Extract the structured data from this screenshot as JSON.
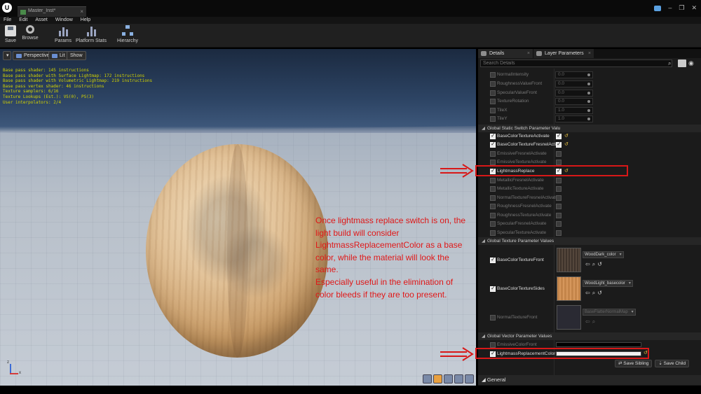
{
  "titlebar": {
    "logo": "U",
    "tab_title": "Master_Inst*",
    "tab_close": "×",
    "controls": [
      "–",
      "❐",
      "✕"
    ]
  },
  "menu": [
    "File",
    "Edit",
    "Asset",
    "Window",
    "Help"
  ],
  "toolbar": {
    "save": "Save",
    "browse": "Browse",
    "params": "Params",
    "platform_stats": "Platform Stats",
    "hierarchy": "Hierarchy"
  },
  "viewport": {
    "menu_caret": "▾",
    "perspective": "Perspective",
    "lit": "Lit",
    "show": "Show",
    "stats": [
      "Base pass shader: 145 instructions",
      "Base pass shader with Surface Lightmap: 172 instructions",
      "Base pass shader with Volumetric Lightmap: 219 instructions",
      "Base pass vertex shader: 46 instructions",
      "Texture samplers: 6/16",
      "Texture Lookups (Est.): VS(0), PS(3)",
      "User interpolators: 2/4"
    ],
    "axis_z": "z",
    "axis_x": "x"
  },
  "annotation": {
    "text1": "Once lightmass replace switch is on, the light build will consider LightmassReplacementColor as a base color, while the material will look the same.",
    "text2": "Especially useful in the elimination of color bleeds if they are too present."
  },
  "panel": {
    "tab_details": "Details",
    "tab_layer": "Layer Parameters",
    "tab_close": "×",
    "search_placeholder": "Search Details",
    "scalar_params": [
      {
        "name": "NormalIntensity",
        "value": "0.0"
      },
      {
        "name": "RoughnessValueFront",
        "value": "0.0"
      },
      {
        "name": "SpecularValueFront",
        "value": "0.0"
      },
      {
        "name": "TextureRotation",
        "value": "0.0"
      },
      {
        "name": "TileX",
        "value": "1.0"
      },
      {
        "name": "TileY",
        "value": "1.0"
      }
    ],
    "static_switch_header": "Global Static Switch Parameter Valu",
    "switches": [
      {
        "name": "BaseColorTextureActivate",
        "on": true
      },
      {
        "name": "BaseColorTextureFresnelActiva",
        "on": true
      },
      {
        "name": "EmissiveFresnelActivate",
        "on": false
      },
      {
        "name": "EmissiveTextureActivate",
        "on": false
      },
      {
        "name": "LightmassReplace",
        "on": true
      },
      {
        "name": "MetallicFresnelActivate",
        "on": false
      },
      {
        "name": "MetallicTextureActivate",
        "on": false
      },
      {
        "name": "NormalTextureFresnelActivate",
        "on": false
      },
      {
        "name": "RoughnessFresnelActivate",
        "on": false
      },
      {
        "name": "RoughnessTextureActivate",
        "on": false
      },
      {
        "name": "SpecularFresnelActivate",
        "on": false
      },
      {
        "name": "SpecularTextureActivate",
        "on": false
      }
    ],
    "texture_header": "Global Texture Parameter Values",
    "textures": [
      {
        "name": "BaseColorTextureFront",
        "asset": "WoodDark_color",
        "on": true,
        "color": "#4a3e34"
      },
      {
        "name": "BaseColorTextureSides",
        "asset": "WoodLight_basecolor",
        "on": true,
        "color": "#c98a4f"
      },
      {
        "name": "NormalTextureFront",
        "asset": "BaseFlatterNormalMap",
        "on": false,
        "color": "#2a2a33"
      }
    ],
    "vector_header": "Global Vector Parameter Values",
    "vectors": [
      {
        "name": "EmissiveColorFront",
        "on": false,
        "color": "#000000"
      },
      {
        "name": "LightmassReplacementColor",
        "on": true,
        "color": "#f2f2f2"
      }
    ],
    "save_sibling": "Save Sibling",
    "save_child": "Save Child",
    "general": "General"
  },
  "colors": {
    "annotation_red": "#d81818",
    "reset_yellow": "#e8c040"
  }
}
